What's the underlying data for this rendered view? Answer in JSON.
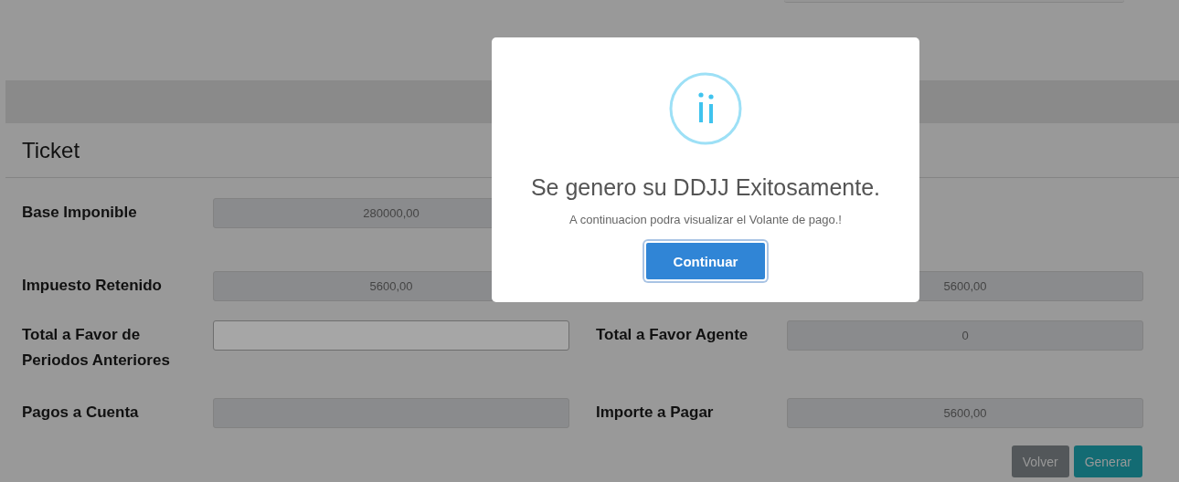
{
  "panel": {
    "title": "Ticket"
  },
  "rows": [
    {
      "left": {
        "label": "Base Imponible",
        "value": "280000,00",
        "disabled": true
      },
      "right": null
    },
    {
      "left": {
        "label": "Impuesto Retenido",
        "value": "5600,00",
        "disabled": true
      },
      "right": {
        "value": "5600,00",
        "disabled": true
      }
    },
    {
      "left": {
        "label": "Total a Favor de Periodos Anteriores",
        "disabled": false
      },
      "right": {
        "label": "Total a Favor Agente",
        "value": "0",
        "disabled": true
      }
    },
    {
      "left": {
        "label": "Pagos a Cuenta",
        "disabled": true
      },
      "right": {
        "label": "Importe a Pagar",
        "value": "5600,00",
        "disabled": true
      }
    }
  ],
  "buttons": [
    {
      "label": "Volver",
      "kind": "secondary"
    },
    {
      "label": "Generar",
      "kind": "primary"
    }
  ],
  "dialog": {
    "title": "Se genero su DDJJ Exitosamente.",
    "message": "A continuacion podra visualizar el Volante de pago.!",
    "button": "Continuar"
  }
}
